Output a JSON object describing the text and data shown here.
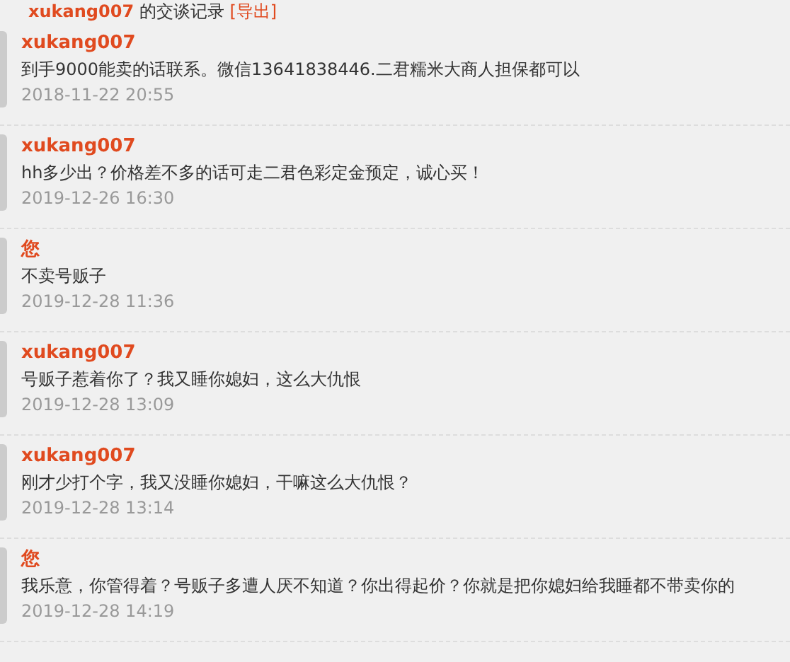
{
  "header": {
    "partner": "xukang007",
    "title": "的交谈记录",
    "export_link": "[导出]"
  },
  "messages": [
    {
      "sender": "xukang007",
      "text": "到手9000能卖的话联系。微信13641838446.二君糯米大商人担保都可以",
      "time": "2018-11-22 20:55"
    },
    {
      "sender": "xukang007",
      "text": "hh多少出？价格差不多的话可走二君色彩定金预定，诚心买！",
      "time": "2019-12-26 16:30"
    },
    {
      "sender": "您",
      "text": "不卖号贩子",
      "time": "2019-12-28 11:36"
    },
    {
      "sender": "xukang007",
      "text": "号贩子惹着你了？我又睡你媳妇，这么大仇恨",
      "time": "2019-12-28 13:09"
    },
    {
      "sender": "xukang007",
      "text": "刚才少打个字，我又没睡你媳妇，干嘛这么大仇恨？",
      "time": "2019-12-28 13:14"
    },
    {
      "sender": "您",
      "text": "我乐意，你管得着？号贩子多遭人厌不知道？你出得起价？你就是把你媳妇给我睡都不带卖你的",
      "time": "2019-12-28 14:19"
    }
  ]
}
